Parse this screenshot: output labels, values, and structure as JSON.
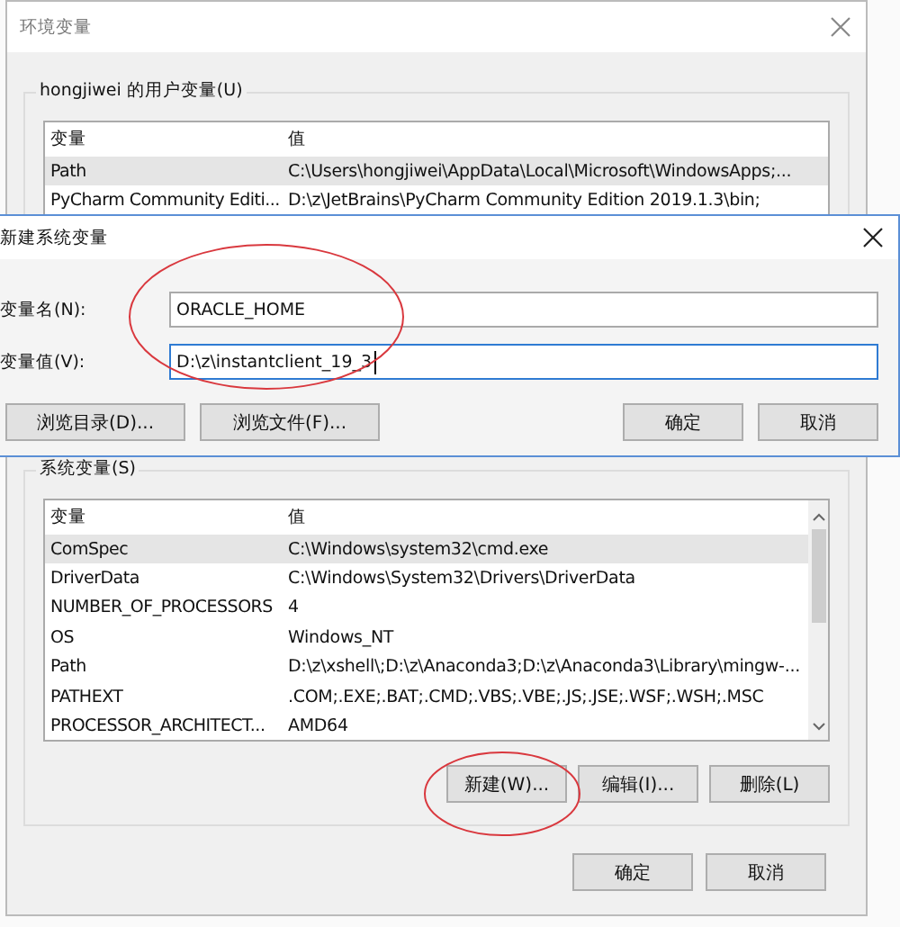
{
  "window": {
    "title": "环境变量"
  },
  "user_variables": {
    "label": "hongjiwei 的用户变量(U)",
    "columns": [
      "变量",
      "值"
    ],
    "rows": [
      {
        "name": "Path",
        "value": "C:\\Users\\hongjiwei\\AppData\\Local\\Microsoft\\WindowsApps;...",
        "selected": true
      },
      {
        "name": "PyCharm Community Editi...",
        "value": "D:\\z\\JetBrains\\PyCharm Community Edition 2019.1.3\\bin;",
        "selected": false
      }
    ]
  },
  "dialog": {
    "title": "新建系统变量",
    "fields": [
      {
        "label": "变量名(N):",
        "value": "ORACLE_HOME",
        "focused": false
      },
      {
        "label": "变量值(V):",
        "value": "D:\\z\\instantclient_19_3",
        "focused": true
      }
    ],
    "buttons_left": [
      "浏览目录(D)...",
      "浏览文件(F)..."
    ],
    "buttons_right": [
      "确定",
      "取消"
    ]
  },
  "system_variables": {
    "label": "系统变量(S)",
    "columns": [
      "变量",
      "值"
    ],
    "rows": [
      {
        "name": "ComSpec",
        "value": "C:\\Windows\\system32\\cmd.exe",
        "selected": true
      },
      {
        "name": "DriverData",
        "value": "C:\\Windows\\System32\\Drivers\\DriverData",
        "selected": false
      },
      {
        "name": "NUMBER_OF_PROCESSORS",
        "value": "4",
        "selected": false
      },
      {
        "name": "OS",
        "value": "Windows_NT",
        "selected": false
      },
      {
        "name": "Path",
        "value": "D:\\z\\xshell\\;D:\\z\\Anaconda3;D:\\z\\Anaconda3\\Library\\mingw-...",
        "selected": false
      },
      {
        "name": "PATHEXT",
        "value": ".COM;.EXE;.BAT;.CMD;.VBS;.VBE;.JS;.JSE;.WSF;.WSH;.MSC",
        "selected": false
      },
      {
        "name": "PROCESSOR_ARCHITECT...",
        "value": "AMD64",
        "selected": false
      }
    ],
    "buttons": [
      "新建(W)...",
      "编辑(I)...",
      "删除(L)"
    ]
  },
  "footer_buttons": [
    "确定",
    "取消"
  ]
}
